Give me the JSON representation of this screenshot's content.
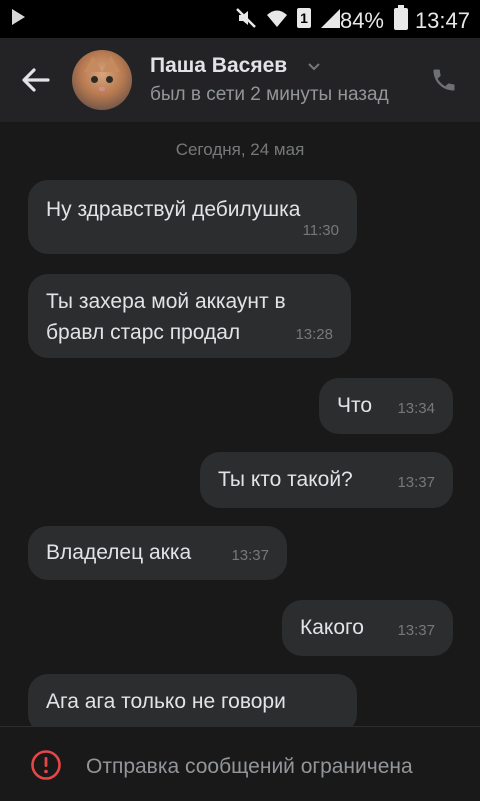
{
  "status_bar": {
    "battery": "84%",
    "time": "13:47",
    "sim": "1"
  },
  "header": {
    "name": "Паша Васяев",
    "status": "был в сети 2 минуты назад"
  },
  "chat": {
    "date": "Сегодня, 24 мая",
    "messages": [
      {
        "text": "Ну здравствуй дебилушка",
        "time": "11:30",
        "direction": "incoming"
      },
      {
        "text": "Ты захера  мой аккаунт в бравл старс продал",
        "time": "13:28",
        "direction": "incoming"
      },
      {
        "text": "Что",
        "time": "13:34",
        "direction": "outgoing"
      },
      {
        "text": "Ты кто такой?",
        "time": "13:37",
        "direction": "outgoing"
      },
      {
        "text": "Владелец акка",
        "time": "13:37",
        "direction": "incoming"
      },
      {
        "text": "Какого",
        "time": "13:37",
        "direction": "outgoing"
      },
      {
        "text": "Ага ага только не говори",
        "time": "",
        "direction": "incoming"
      }
    ]
  },
  "bottom": {
    "restriction_text": "Отправка сообщений ограничена"
  },
  "colors": {
    "background": "#19191a",
    "header": "#232325",
    "bubble": "#2c2d2e",
    "warning": "#e64646"
  }
}
